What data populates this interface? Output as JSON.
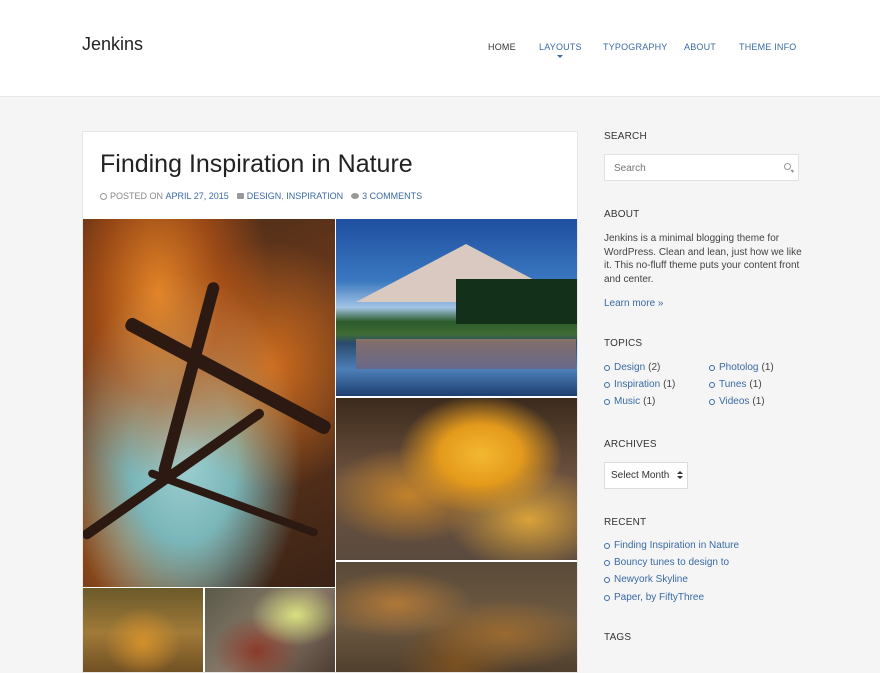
{
  "site": {
    "title": "Jenkins"
  },
  "nav": {
    "items": [
      {
        "label": "HOME"
      },
      {
        "label": "LAYOUTS"
      },
      {
        "label": "TYPOGRAPHY"
      },
      {
        "label": "ABOUT"
      },
      {
        "label": "THEME INFO"
      }
    ]
  },
  "post": {
    "title": "Finding Inspiration in Nature",
    "meta": {
      "posted_on_label": "POSTED ON",
      "date": "APRIL 27, 2015",
      "category_1": "DESIGN",
      "category_sep": ",",
      "category_2": "INSPIRATION",
      "comments": "3 COMMENTS"
    }
  },
  "sidebar": {
    "search": {
      "title": "SEARCH",
      "placeholder": "Search"
    },
    "about": {
      "title": "ABOUT",
      "text": "Jenkins is a minimal blogging theme for WordPress. Clean and lean, just how we like it. This no-fluff theme puts your content front and center.",
      "learn_more": "Learn more »"
    },
    "topics": {
      "title": "TOPICS",
      "items": [
        {
          "label": "Design",
          "count": "(2)"
        },
        {
          "label": "Photolog",
          "count": "(1)"
        },
        {
          "label": "Inspiration",
          "count": "(1)"
        },
        {
          "label": "Tunes",
          "count": "(1)"
        },
        {
          "label": "Music",
          "count": "(1)"
        },
        {
          "label": "Videos",
          "count": "(1)"
        }
      ]
    },
    "archives": {
      "title": "ARCHIVES",
      "select_value": "Select Month"
    },
    "recent": {
      "title": "RECENT",
      "items": [
        "Finding Inspiration in Nature",
        "Bouncy tunes to design to",
        "Newyork Skyline",
        "Paper, by FiftyThree"
      ]
    },
    "tags": {
      "title": "TAGS"
    }
  },
  "colors": {
    "accent": "#3a6aa5",
    "background": "#f5f5f5",
    "card": "#ffffff"
  }
}
